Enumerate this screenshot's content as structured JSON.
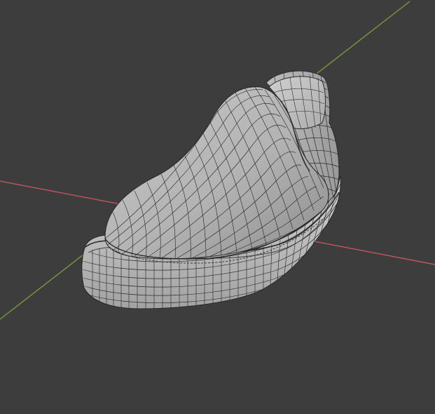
{
  "viewport": {
    "background": "#3d3d3d",
    "shading": "solid",
    "overlay": "wireframe",
    "object": "shoe-mesh"
  },
  "axes": {
    "x_axis_color": "#c45560",
    "y_axis_color": "#7a9a3c"
  },
  "mesh": {
    "surface_light": "#c8c8c8",
    "surface_mid": "#a9a9a9",
    "surface_dark": "#8a8a8a",
    "wire_color": "#2b2b2b"
  }
}
